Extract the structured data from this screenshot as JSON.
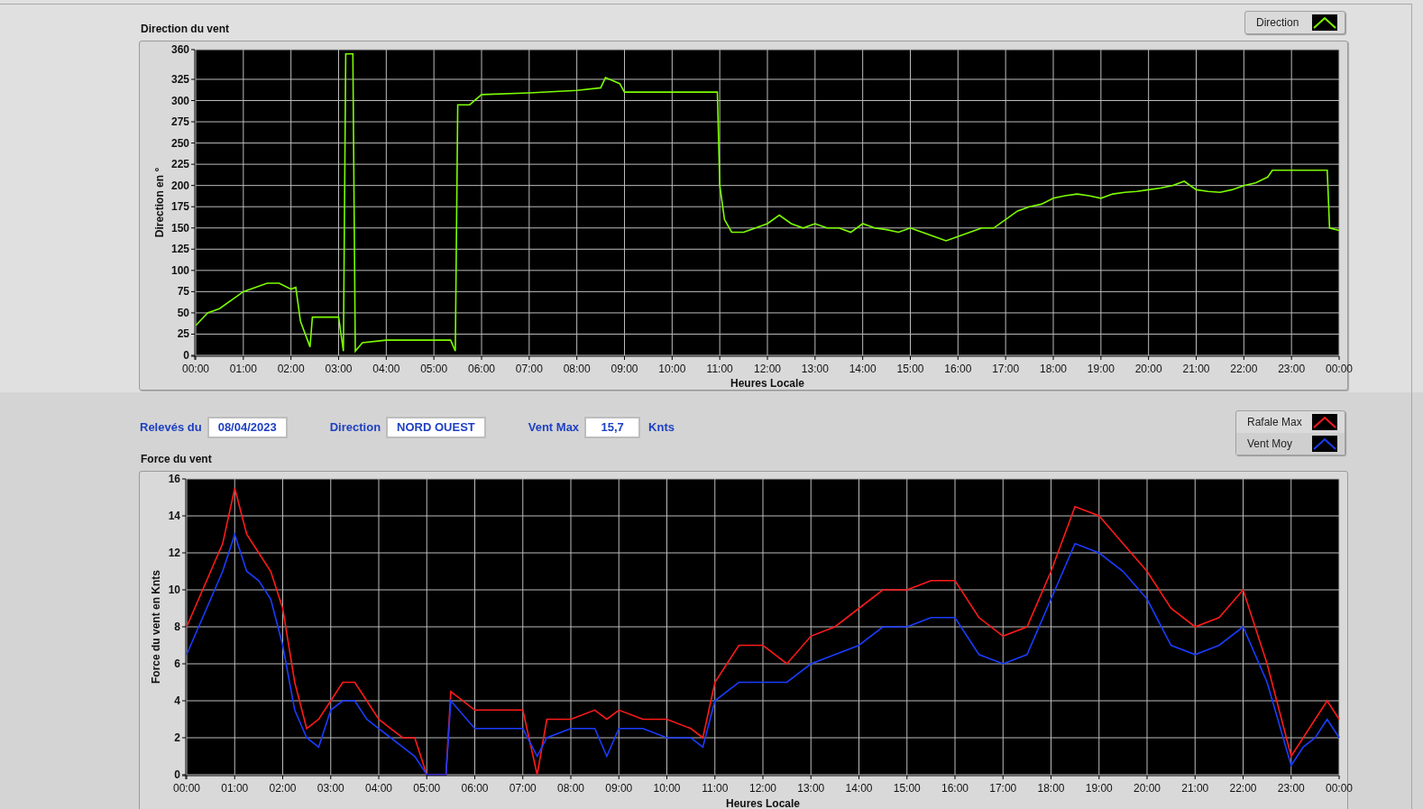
{
  "direction_chart": {
    "chart_data": {
      "type": "line",
      "title": "Direction du vent",
      "grid": true,
      "xlabel": "Heures Locale",
      "ylabel": "Direction en °",
      "xlim": [
        0,
        24
      ],
      "ylim": [
        0,
        360
      ],
      "x": [
        0,
        0.25,
        0.5,
        0.75,
        1,
        1.25,
        1.5,
        1.75,
        2,
        2.1,
        2.2,
        2.4,
        2.45,
        3,
        3.1,
        3.15,
        3.3,
        3.35,
        3.5,
        4,
        5,
        5.35,
        5.45,
        5.5,
        5.75,
        6,
        7,
        8,
        8.5,
        8.6,
        8.9,
        9,
        10,
        10.95,
        11,
        11.1,
        11.25,
        11.5,
        11.75,
        12,
        12.25,
        12.5,
        12.75,
        13,
        13.25,
        13.5,
        13.75,
        14,
        14.25,
        14.5,
        14.75,
        15,
        15.25,
        15.5,
        15.75,
        16,
        16.25,
        16.5,
        16.75,
        17,
        17.25,
        17.5,
        17.75,
        18,
        18.25,
        18.5,
        18.75,
        19,
        19.25,
        19.5,
        19.75,
        20,
        20.25,
        20.5,
        20.75,
        21,
        21.25,
        21.5,
        21.75,
        22,
        22.25,
        22.5,
        22.6,
        23,
        23.5,
        23.75,
        23.8,
        24
      ],
      "series": [
        {
          "name": "Direction",
          "color": "#7cfc00",
          "values": [
            35,
            50,
            55,
            65,
            75,
            80,
            85,
            85,
            78,
            80,
            40,
            10,
            45,
            45,
            5,
            355,
            355,
            5,
            15,
            18,
            18,
            18,
            5,
            295,
            295,
            307,
            309,
            312,
            315,
            327,
            320,
            310,
            310,
            310,
            200,
            160,
            145,
            145,
            150,
            155,
            165,
            155,
            150,
            155,
            150,
            150,
            145,
            155,
            150,
            148,
            145,
            150,
            145,
            140,
            135,
            140,
            145,
            150,
            150,
            160,
            170,
            175,
            178,
            185,
            188,
            190,
            188,
            185,
            190,
            192,
            193,
            195,
            197,
            200,
            205,
            195,
            193,
            192,
            195,
            200,
            203,
            210,
            218,
            218,
            218,
            218,
            150,
            147
          ]
        }
      ],
      "xticks": [
        {
          "value": 0,
          "label": "00:00"
        },
        {
          "value": 1,
          "label": "01:00"
        },
        {
          "value": 2,
          "label": "02:00"
        },
        {
          "value": 3,
          "label": "03:00"
        },
        {
          "value": 4,
          "label": "04:00"
        },
        {
          "value": 5,
          "label": "05:00"
        },
        {
          "value": 6,
          "label": "06:00"
        },
        {
          "value": 7,
          "label": "07:00"
        },
        {
          "value": 8,
          "label": "08:00"
        },
        {
          "value": 9,
          "label": "09:00"
        },
        {
          "value": 10,
          "label": "10:00"
        },
        {
          "value": 11,
          "label": "11:00"
        },
        {
          "value": 12,
          "label": "12:00"
        },
        {
          "value": 13,
          "label": "13:00"
        },
        {
          "value": 14,
          "label": "14:00"
        },
        {
          "value": 15,
          "label": "15:00"
        },
        {
          "value": 16,
          "label": "16:00"
        },
        {
          "value": 17,
          "label": "17:00"
        },
        {
          "value": 18,
          "label": "18:00"
        },
        {
          "value": 19,
          "label": "19:00"
        },
        {
          "value": 20,
          "label": "20:00"
        },
        {
          "value": 21,
          "label": "21:00"
        },
        {
          "value": 22,
          "label": "22:00"
        },
        {
          "value": 23,
          "label": "23:00"
        },
        {
          "value": 24,
          "label": "00:00"
        }
      ],
      "yticks": [
        0,
        25,
        50,
        75,
        100,
        125,
        150,
        175,
        200,
        225,
        250,
        275,
        300,
        325,
        360
      ]
    }
  },
  "readings": [
    {
      "label": "Relevés du",
      "value": "08/04/2023"
    },
    {
      "label": "Direction",
      "value": "NORD OUEST"
    },
    {
      "label": "Vent Max",
      "value": "15,7",
      "unit": "Knts"
    }
  ],
  "force_chart": {
    "chart_data": {
      "type": "line",
      "title": "Force du vent",
      "grid": true,
      "xlabel": "Heures Locale",
      "ylabel": "Force du vent en Knts",
      "xlim": [
        0,
        24
      ],
      "ylim": [
        0,
        16
      ],
      "x": [
        0,
        0.5,
        0.75,
        1,
        1.25,
        1.5,
        1.75,
        2,
        2.25,
        2.5,
        2.75,
        3,
        3.25,
        3.5,
        3.75,
        4,
        4.25,
        4.5,
        4.75,
        5,
        5.4,
        5.5,
        6,
        6.5,
        7,
        7.3,
        7.5,
        8,
        8.5,
        8.75,
        9,
        9.5,
        10,
        10.5,
        10.75,
        11,
        11.5,
        12,
        12.5,
        13,
        13.5,
        14,
        14.5,
        15,
        15.5,
        16,
        16.5,
        17,
        17.5,
        18,
        18.5,
        19,
        19.5,
        20,
        20.5,
        21,
        21.5,
        22,
        22.5,
        23,
        23.25,
        23.5,
        23.75,
        24
      ],
      "series": [
        {
          "name": "Rafale Max",
          "color": "#ff1a1a",
          "values": [
            8,
            11,
            12.5,
            15.5,
            13,
            12,
            11,
            9,
            5,
            2.5,
            3,
            4,
            5,
            5,
            4,
            3,
            2.5,
            2,
            2,
            0,
            0,
            4.5,
            3.5,
            3.5,
            3.5,
            0,
            3,
            3,
            3.5,
            3,
            3.5,
            3,
            3,
            2.5,
            2,
            5,
            7,
            7,
            6,
            7.5,
            8,
            9,
            10,
            10,
            10.5,
            10.5,
            8.5,
            7.5,
            8,
            11,
            14.5,
            14,
            12.5,
            11,
            9,
            8,
            8.5,
            10,
            6,
            1,
            2,
            3,
            4,
            3
          ]
        },
        {
          "name": "Vent Moy",
          "color": "#1a3cff",
          "values": [
            6.5,
            9.5,
            11,
            13,
            11,
            10.5,
            9.5,
            7,
            3.5,
            2,
            1.5,
            3.5,
            4,
            4,
            3,
            2.5,
            2,
            1.5,
            1,
            0,
            0,
            4,
            2.5,
            2.5,
            2.5,
            1,
            2,
            2.5,
            2.5,
            1,
            2.5,
            2.5,
            2,
            2,
            1.5,
            4,
            5,
            5,
            5,
            6,
            6.5,
            7,
            8,
            8,
            8.5,
            8.5,
            6.5,
            6,
            6.5,
            9.5,
            12.5,
            12,
            11,
            9.5,
            7,
            6.5,
            7,
            8,
            5,
            0.5,
            1.5,
            2,
            3,
            2
          ]
        }
      ],
      "xticks": [
        {
          "value": 0,
          "label": "00:00"
        },
        {
          "value": 1,
          "label": "01:00"
        },
        {
          "value": 2,
          "label": "02:00"
        },
        {
          "value": 3,
          "label": "03:00"
        },
        {
          "value": 4,
          "label": "04:00"
        },
        {
          "value": 5,
          "label": "05:00"
        },
        {
          "value": 6,
          "label": "06:00"
        },
        {
          "value": 7,
          "label": "07:00"
        },
        {
          "value": 8,
          "label": "08:00"
        },
        {
          "value": 9,
          "label": "09:00"
        },
        {
          "value": 10,
          "label": "10:00"
        },
        {
          "value": 11,
          "label": "11:00"
        },
        {
          "value": 12,
          "label": "12:00"
        },
        {
          "value": 13,
          "label": "13:00"
        },
        {
          "value": 14,
          "label": "14:00"
        },
        {
          "value": 15,
          "label": "15:00"
        },
        {
          "value": 16,
          "label": "16:00"
        },
        {
          "value": 17,
          "label": "17:00"
        },
        {
          "value": 18,
          "label": "18:00"
        },
        {
          "value": 19,
          "label": "19:00"
        },
        {
          "value": 20,
          "label": "20:00"
        },
        {
          "value": 21,
          "label": "21:00"
        },
        {
          "value": 22,
          "label": "22:00"
        },
        {
          "value": 23,
          "label": "23:00"
        },
        {
          "value": 24,
          "label": "00:00"
        }
      ],
      "yticks": [
        0,
        2,
        4,
        6,
        8,
        10,
        12,
        14,
        16
      ]
    }
  }
}
